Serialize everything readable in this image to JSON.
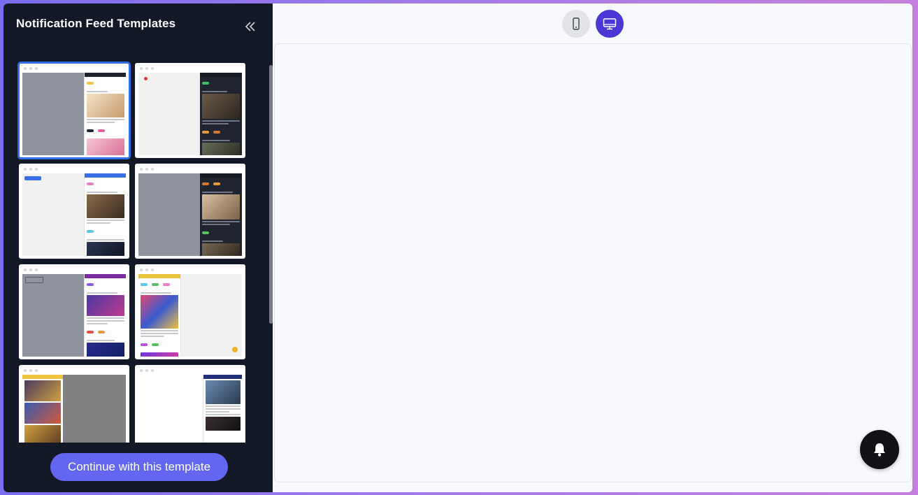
{
  "sidebar": {
    "title": "Notification Feed Templates",
    "collapse_icon": "double-chevron-left-icon",
    "continue_label": "Continue with this template",
    "templates": [
      {
        "id": "template-1",
        "selected": true
      },
      {
        "id": "template-2",
        "selected": false
      },
      {
        "id": "template-3",
        "selected": false
      },
      {
        "id": "template-4",
        "selected": false
      },
      {
        "id": "template-5",
        "selected": false
      },
      {
        "id": "template-6",
        "selected": false
      },
      {
        "id": "template-7",
        "selected": false
      },
      {
        "id": "template-8",
        "selected": false
      }
    ]
  },
  "toolbar": {
    "mobile_icon": "mobile-phone-icon",
    "desktop_icon": "desktop-monitor-icon",
    "active_view": "desktop"
  },
  "widget": {
    "bell_icon": "bell-icon"
  },
  "colors": {
    "sidebar_bg": "#121826",
    "accent": "#6366f1",
    "desktop_active": "#4a37d6",
    "selected_outline": "#2f6ee6"
  }
}
